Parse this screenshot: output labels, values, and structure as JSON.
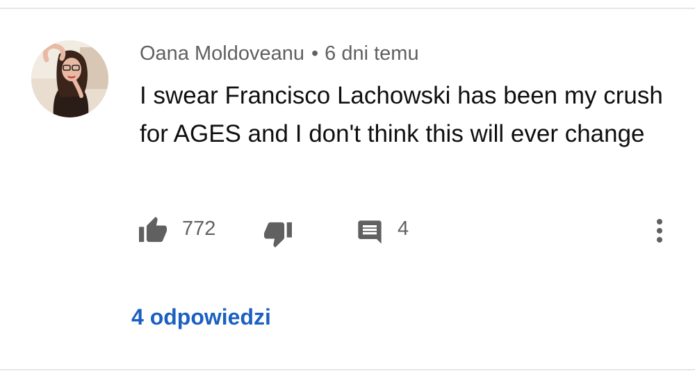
{
  "comment": {
    "author": "Oana Moldoveanu",
    "separator": "•",
    "timestamp": "6 dni temu",
    "text": "I swear Francisco Lachowski has been my crush for AGES and I don't think this will ever change",
    "like_count": "772",
    "reply_count": "4",
    "replies_link": "4 odpowiedzi"
  },
  "icons": {
    "avatar": "user-avatar-photo",
    "like": "thumbs-up-icon",
    "dislike": "thumbs-down-icon",
    "reply": "comment-icon",
    "more": "more-vertical-icon"
  },
  "colors": {
    "icon_gray": "#606060",
    "text_primary": "#0f0f0f",
    "link_blue": "#1a60c2",
    "divider": "#e6e6e6"
  }
}
